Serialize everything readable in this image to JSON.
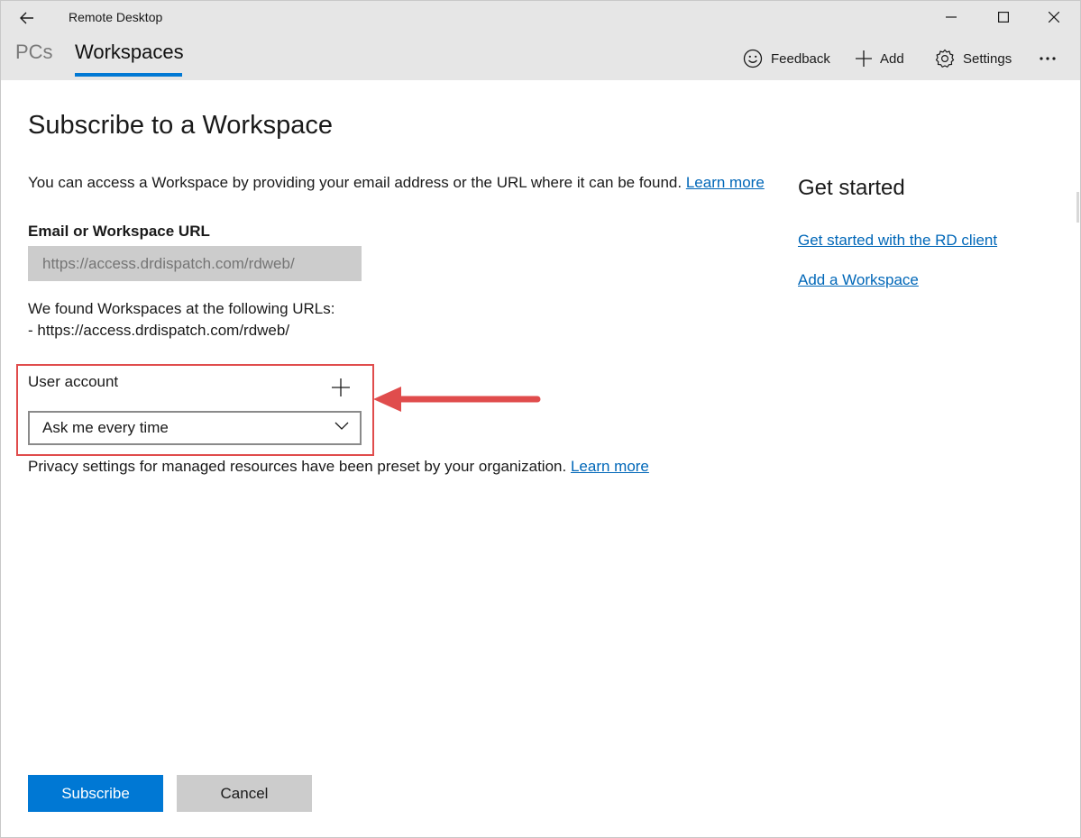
{
  "window": {
    "title": "Remote Desktop"
  },
  "tabs": [
    {
      "label": "PCs",
      "selected": false
    },
    {
      "label": "Workspaces",
      "selected": true
    }
  ],
  "toolbar": {
    "feedback_label": "Feedback",
    "feedback_icon": "smiley-icon",
    "add_label": "Add",
    "add_icon": "plus-icon",
    "settings_label": "Settings",
    "settings_icon": "gear-icon",
    "more_icon": "ellipsis-icon"
  },
  "subscribe": {
    "heading": "Subscribe to a Workspace",
    "intro_text": "You can access a Workspace by providing your email address or the URL where it can be found.",
    "intro_link": "Learn more",
    "field_label": "Email or Workspace URL",
    "url_placeholder": "https://access.drdispatch.com/rdweb/",
    "found_line1": "We found Workspaces at the following URLs:",
    "found_line2": "- https://access.drdispatch.com/rdweb/",
    "user_account_label": "User account",
    "user_account_selected": "Ask me every time",
    "privacy_text": "Privacy settings for managed resources have been preset by your organization.",
    "privacy_link": "Learn more"
  },
  "sidebar": {
    "title": "Get started",
    "links": [
      "Get started with the RD client",
      "Add a Workspace"
    ]
  },
  "actions": {
    "subscribe_label": "Subscribe",
    "cancel_label": "Cancel"
  },
  "colors": {
    "accent": "#0078d4",
    "link": "#0067b8",
    "annotation": "#e04c4c",
    "titlebar": "#e6e6e6"
  }
}
